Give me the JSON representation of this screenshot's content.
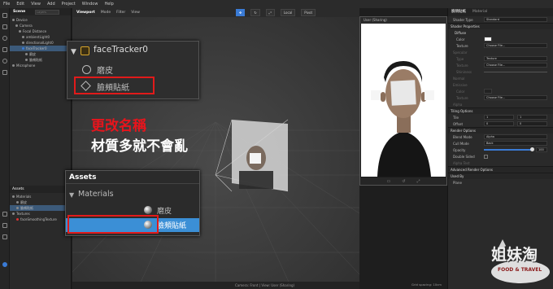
{
  "menu": [
    "File",
    "Edit",
    "View",
    "Add",
    "Project",
    "Window",
    "Help"
  ],
  "scene_panel": {
    "tabs": [
      "Scene",
      "Layers"
    ],
    "search_placeholder": "Layers",
    "tree": [
      {
        "label": "Device",
        "indent": 0,
        "color": "#8a8a8a"
      },
      {
        "label": "Camera",
        "indent": 1,
        "color": "#8a8a8a"
      },
      {
        "label": "Focal Distance",
        "indent": 2,
        "color": "#8a8a8a"
      },
      {
        "label": "ambientLight0",
        "indent": 3,
        "color": "#8a8a8a"
      },
      {
        "label": "directionalLight0",
        "indent": 3,
        "color": "#8a8a8a"
      },
      {
        "label": "faceTracker0",
        "indent": 3,
        "color": "#3a7bd5",
        "selected": true
      },
      {
        "label": "磨皮",
        "indent": 4,
        "color": "#8a8a8a"
      },
      {
        "label": "臉頰貼紙",
        "indent": 4,
        "color": "#8a8a8a"
      },
      {
        "label": "Microphone",
        "indent": 0,
        "color": "#8a8a8a"
      }
    ],
    "assets_title": "Assets",
    "assets": [
      {
        "label": "Materials",
        "indent": 0
      },
      {
        "label": "磨皮",
        "indent": 1
      },
      {
        "label": "臉頰貼紙",
        "indent": 1,
        "selected": true
      },
      {
        "label": "Textures",
        "indent": 0
      },
      {
        "label": "faceSmoothingTexture",
        "indent": 1
      }
    ]
  },
  "viewport": {
    "title": "Viewport",
    "modes": [
      "Mode",
      "Filter",
      "View"
    ],
    "tools": [
      "Local",
      "Pivot"
    ],
    "status_left": "Camera: Front | View: User (Sharing)",
    "status_right": "Grid spacing: 10cm"
  },
  "preview": {
    "title": "User (Sharing)"
  },
  "overlay_scene": {
    "node": "faceTracker0",
    "children": [
      "磨皮",
      "臉頰貼紙"
    ]
  },
  "overlay_assets": {
    "title": "Assets",
    "folder": "Materials",
    "items": [
      "磨皮",
      "臉頰貼紙"
    ]
  },
  "caption": {
    "line1": "更改名稱",
    "line2": "材質多就不會亂",
    "line1_color": "#e8141c",
    "line2_color": "#ffffff"
  },
  "inspector": {
    "title": "臉頰貼紙",
    "subtitle": "Material",
    "shader_type_label": "Shader Type",
    "shader_type_value": "Standard",
    "shader_properties": "Shader Properties",
    "diffuse": "Diffuse",
    "color_label": "Color",
    "texture_label": "Texture",
    "texture_value": "Choose File...",
    "specular": "Specular",
    "type_label": "Type",
    "type_value": "Texture",
    "texture2_value": "Choose File...",
    "shininess_label": "Shininess",
    "normal": "Normal",
    "emissive": "Emissive",
    "alpha": "Alpha",
    "tiling": "Tiling Options",
    "tile_label": "Tile",
    "tile_x": "1",
    "tile_y": "1",
    "offset_label": "Offset",
    "offset_x": "0",
    "offset_y": "0",
    "render_options": "Render Options",
    "blend_mode_label": "Blend Mode",
    "blend_mode_value": "Alpha",
    "cull_mode_label": "Cull Mode",
    "cull_mode_value": "Back",
    "opacity_label": "Opacity",
    "opacity_value": "100",
    "opacity_level": 1.0,
    "double_sided_label": "Double Sided",
    "alpha_test": "Alpha Test",
    "advanced": "Advanced Render Options",
    "used_by": "Used By",
    "used_by_item": "Plane"
  },
  "watermark": {
    "brand": "姐妹淘",
    "sub": "FOOD & TRAVEL"
  }
}
